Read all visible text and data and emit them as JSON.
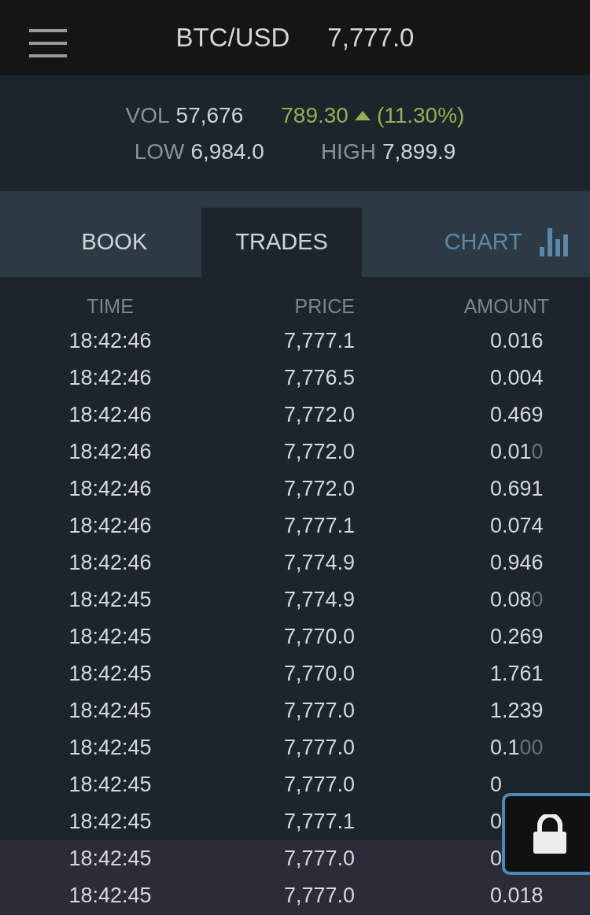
{
  "header": {
    "pair": "BTC/USD",
    "price": "7,777.0"
  },
  "stats": {
    "vol_label": "VOL",
    "vol": "57,676",
    "change": "789.30",
    "rising": true,
    "change_pct": "(11.30%)",
    "low_label": "LOW",
    "low": "6,984.0",
    "high_label": "HIGH",
    "high": "7,899.9"
  },
  "tabs": [
    {
      "label": "BOOK",
      "selected": false,
      "kind": "plain"
    },
    {
      "label": "TRADES",
      "selected": true,
      "kind": "plain"
    },
    {
      "label": "CHART",
      "selected": false,
      "kind": "chart"
    }
  ],
  "table": {
    "columns": [
      "TIME",
      "PRICE",
      "AMOUNT"
    ],
    "rows": [
      {
        "time": "18:42:46",
        "price": "7,777.1",
        "amount": "0.016",
        "highlighted": false
      },
      {
        "time": "18:42:46",
        "price": "7,776.5",
        "amount": "0.004",
        "highlighted": false
      },
      {
        "time": "18:42:46",
        "price": "7,772.0",
        "amount": "0.469",
        "highlighted": false
      },
      {
        "time": "18:42:46",
        "price": "7,772.0",
        "amount": "0.01",
        "amount_pad": "0",
        "highlighted": false
      },
      {
        "time": "18:42:46",
        "price": "7,772.0",
        "amount": "0.691",
        "highlighted": false
      },
      {
        "time": "18:42:46",
        "price": "7,777.1",
        "amount": "0.074",
        "highlighted": false
      },
      {
        "time": "18:42:46",
        "price": "7,774.9",
        "amount": "0.946",
        "highlighted": false
      },
      {
        "time": "18:42:45",
        "price": "7,774.9",
        "amount": "0.08",
        "amount_pad": "0",
        "highlighted": false
      },
      {
        "time": "18:42:45",
        "price": "7,770.0",
        "amount": "0.269",
        "highlighted": false
      },
      {
        "time": "18:42:45",
        "price": "7,770.0",
        "amount": "1.761",
        "highlighted": false
      },
      {
        "time": "18:42:45",
        "price": "7,777.0",
        "amount": "1.239",
        "highlighted": false
      },
      {
        "time": "18:42:45",
        "price": "7,777.0",
        "amount": "0.1",
        "amount_pad": "00",
        "highlighted": false
      },
      {
        "time": "18:42:45",
        "price": "7,777.0",
        "amount": "0",
        "highlighted": false
      },
      {
        "time": "18:42:45",
        "price": "7,777.1",
        "amount": "0",
        "highlighted": false
      },
      {
        "time": "18:42:45",
        "price": "7,777.0",
        "amount": "0",
        "highlighted": true
      },
      {
        "time": "18:42:45",
        "price": "7,777.0",
        "amount": "0.018",
        "highlighted": true
      }
    ]
  }
}
